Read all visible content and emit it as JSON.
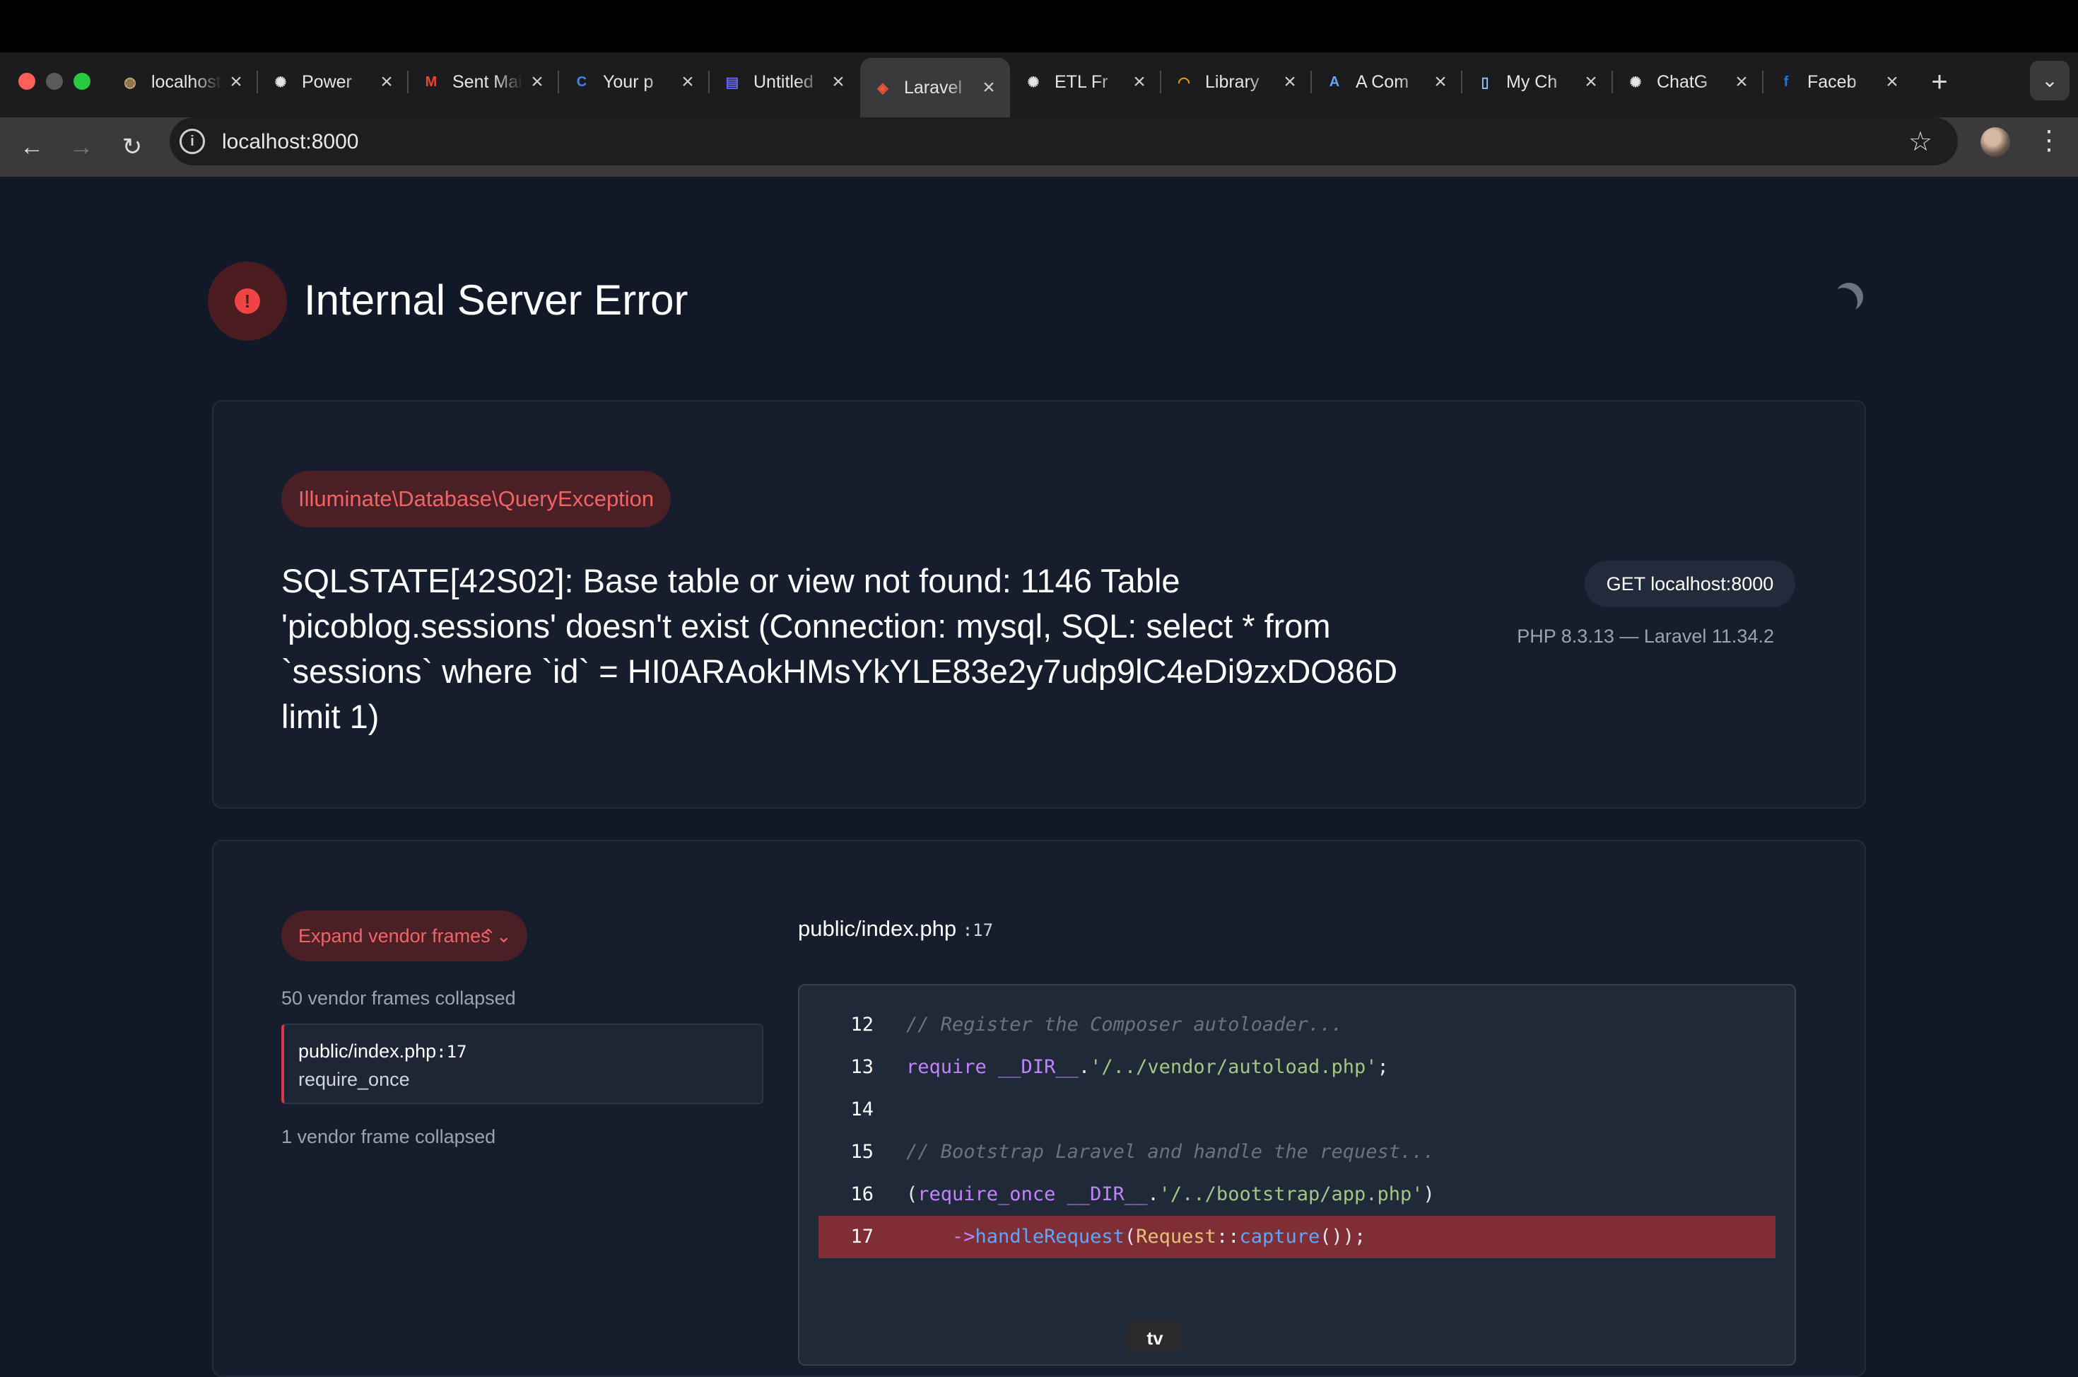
{
  "browser": {
    "tabs": [
      {
        "title": "localhost",
        "icon": "tool-circle-icon",
        "color": "#c9a36b"
      },
      {
        "title": "Power",
        "icon": "openai-icon",
        "color": "#e5e5e5"
      },
      {
        "title": "Sent Mail",
        "icon": "gmail-icon",
        "color": "#ea4335"
      },
      {
        "title": "Your p",
        "icon": "c-logo-icon",
        "color": "#3b82f6"
      },
      {
        "title": "Untitled",
        "icon": "doc-icon",
        "color": "#6366f1"
      },
      {
        "title": "Laravel",
        "icon": "laravel-icon",
        "color": "#f05340",
        "active": true
      },
      {
        "title": "ETL Fr",
        "icon": "openai-icon",
        "color": "#e5e5e5"
      },
      {
        "title": "Library",
        "icon": "rainbow-icon",
        "color": "#f59e0b"
      },
      {
        "title": "A Com",
        "icon": "a-logo-icon",
        "color": "#60a5fa"
      },
      {
        "title": "My Ch",
        "icon": "notebook-icon",
        "color": "#93c5fd"
      },
      {
        "title": "ChatG",
        "icon": "openai-icon",
        "color": "#e5e5e5"
      },
      {
        "title": "Faceb",
        "icon": "facebook-icon",
        "color": "#1877f2"
      }
    ],
    "close_glyph": "×",
    "new_tab_glyph": "+",
    "address": "localhost:8000"
  },
  "page": {
    "title": "Internal Server Error",
    "error_glyph": "!",
    "exception_class": "Illuminate\\Database\\QueryException",
    "message": "SQLSTATE[42S02]: Base table or view not found: 1146 Table 'picoblog.sessions' doesn't exist (Connection: mysql, SQL: select * from `sessions` where `id` = HI0ARAokHMsYkYLE83e2y7udp9lC4eDi9zxDO86D limit 1)",
    "request": "GET localhost:8000",
    "versions": "PHP 8.3.13 — Laravel 11.34.2"
  },
  "trace": {
    "expand_label": "Expand vendor frames",
    "collapsed_top": "50 vendor frames collapsed",
    "frame_file": "public/index.php",
    "frame_line": ":17",
    "frame_function": "require_once",
    "collapsed_bottom": "1 vendor frame collapsed"
  },
  "code": {
    "path": "public/index.php",
    "line_ref": ":17",
    "lines": [
      {
        "num": "12",
        "tokens": [
          {
            "t": "// Register the Composer autoloader...",
            "c": "c-com"
          }
        ]
      },
      {
        "num": "13",
        "tokens": [
          {
            "t": "require ",
            "c": "c-kw"
          },
          {
            "t": "__DIR__",
            "c": "c-const"
          },
          {
            "t": ".",
            "c": "c-op"
          },
          {
            "t": "'/../vendor/autoload.php'",
            "c": "c-str"
          },
          {
            "t": ";",
            "c": "c-op"
          }
        ]
      },
      {
        "num": "14",
        "tokens": []
      },
      {
        "num": "15",
        "tokens": [
          {
            "t": "// Bootstrap Laravel and handle the request...",
            "c": "c-com"
          }
        ]
      },
      {
        "num": "16",
        "tokens": [
          {
            "t": "(",
            "c": "c-op"
          },
          {
            "t": "require_once ",
            "c": "c-kw"
          },
          {
            "t": "__DIR__",
            "c": "c-const"
          },
          {
            "t": ".",
            "c": "c-op"
          },
          {
            "t": "'/../bootstrap/app.php'",
            "c": "c-str"
          },
          {
            "t": ")",
            "c": "c-op"
          }
        ]
      },
      {
        "num": "17",
        "highlight": true,
        "tokens": [
          {
            "t": "    ->",
            "c": "c-kw"
          },
          {
            "t": "handleRequest",
            "c": "c-fn"
          },
          {
            "t": "(",
            "c": "c-op"
          },
          {
            "t": "Request",
            "c": "c-cls"
          },
          {
            "t": "::",
            "c": "c-op"
          },
          {
            "t": "capture",
            "c": "c-fn"
          },
          {
            "t": "());",
            "c": "c-op"
          }
        ]
      }
    ]
  },
  "overlay": {
    "appletv_label": "tv"
  },
  "colors": {
    "accent_red": "#f16464",
    "badge_bg": "#4a1f26",
    "highlight_row": "#7f2e35",
    "page_bg": "#111827"
  }
}
